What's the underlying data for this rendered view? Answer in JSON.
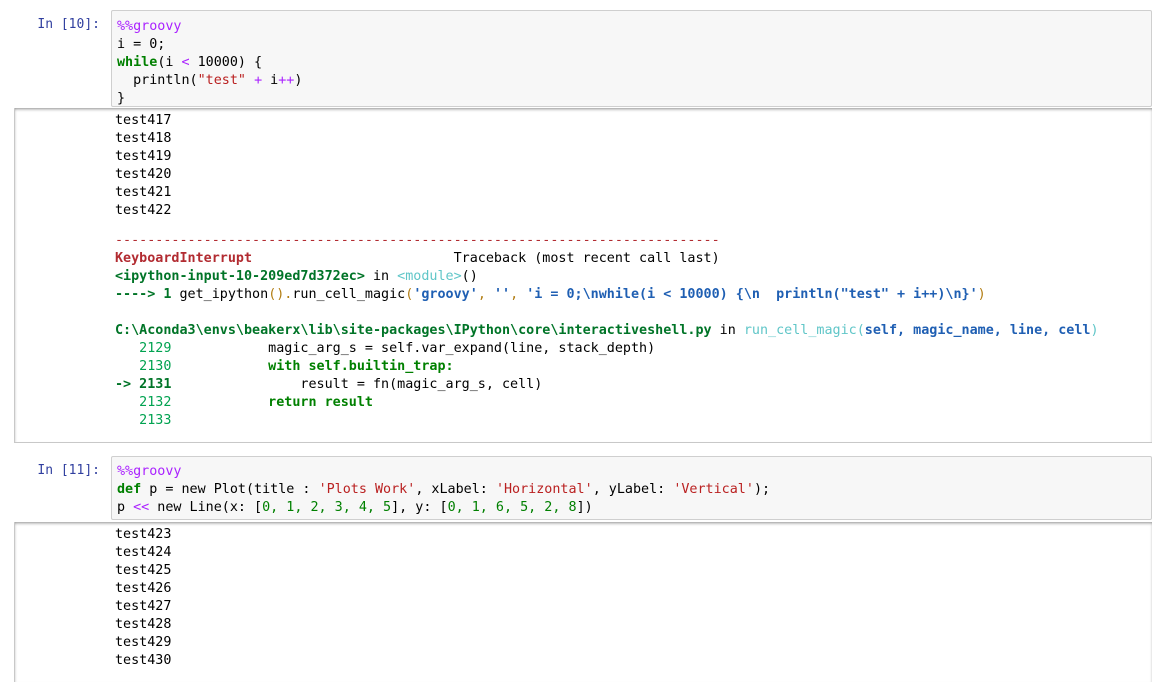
{
  "cell10": {
    "prompt": "In [10]:",
    "code": {
      "l1_magic": "%%groovy",
      "l2": "i = 0;",
      "l3_kw": "while",
      "l3_a": "(i ",
      "l3_op": "<",
      "l3_b": " 10000) {",
      "l4_a": "  println(",
      "l4_str": "\"test\"",
      "l4_b": " ",
      "l4_op": "+",
      "l4_c": " i",
      "l4_op2": "++",
      "l4_d": ")",
      "l5": "}"
    },
    "output_lines": [
      "test417",
      "test418",
      "test419",
      "test420",
      "test421",
      "test422"
    ],
    "traceback": {
      "dashes": "---------------------------------------------------------------------------",
      "error_name": "KeyboardInterrupt",
      "header_right": "                         Traceback (most recent call last)",
      "input_ref": "<ipython-input-10-209ed7d372ec>",
      "in_word": " in ",
      "module": "<module>",
      "module_paren": "()",
      "arrow_line_num": "----> 1 ",
      "arrow_line_a": "get_ipython",
      "arrow_line_b": "().",
      "arrow_line_c": "run_cell_magic",
      "arrow_line_d": "(",
      "arrow_str1": "'groovy'",
      "arrow_comma1": ", ",
      "arrow_str2": "''",
      "arrow_comma2": ", ",
      "arrow_str3": "'i = 0;\\nwhile(i < 10000) {\\n  println(\"test\" + i++)\\n}'",
      "arrow_close": ")",
      "file_path": "C:\\Aconda3\\envs\\beakerx\\lib\\site-packages\\IPython\\core\\interactiveshell.py",
      "file_in": " in ",
      "func_name": "run_cell_magic",
      "func_args_open": "(",
      "func_args": "self, magic_name, line, cell",
      "func_args_close": ")",
      "src_lines": [
        {
          "num": "   2129",
          "code": "            magic_arg_s = self.var_expand(line, stack_depth)"
        },
        {
          "num": "   2130",
          "code": "            with self.builtin_trap:"
        },
        {
          "num": "-> 2131",
          "code": "                result = fn(magic_arg_s, cell)"
        },
        {
          "num": "   2132",
          "code": "            return result"
        },
        {
          "num": "   2133",
          "code": ""
        }
      ]
    }
  },
  "cell11": {
    "prompt": "In [11]:",
    "code": {
      "l1_magic": "%%groovy",
      "l2_kw": "def",
      "l2_a": " p = new Plot(title : ",
      "l2_s1": "'Plots Work'",
      "l2_b": ", xLabel: ",
      "l2_s2": "'Horizontal'",
      "l2_c": ", yLabel: ",
      "l2_s3": "'Vertical'",
      "l2_d": ");",
      "l3_a": "p ",
      "l3_op": "<<",
      "l3_b": " new Line(x: [",
      "l3_nums_x": "0, 1, 2, 3, 4, 5",
      "l3_c": "], y: [",
      "l3_nums_y": "0, 1, 6, 5, 2, 8",
      "l3_d": "])"
    },
    "output_lines": [
      "test423",
      "test424",
      "test425",
      "test426",
      "test427",
      "test428",
      "test429",
      "test430"
    ]
  }
}
